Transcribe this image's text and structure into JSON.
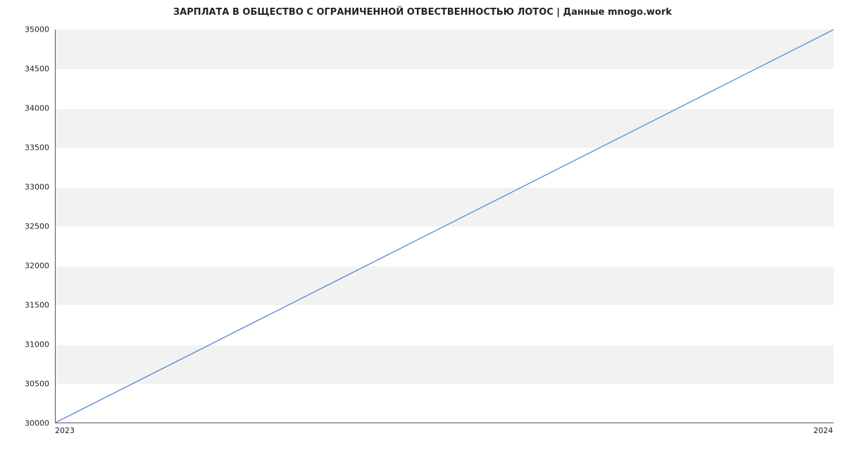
{
  "chart_data": {
    "type": "line",
    "title": "ЗАРПЛАТА В ОБЩЕСТВО С ОГРАНИЧЕННОЙ ОТВЕСТВЕННОСТЬЮ ЛОТОС | Данные mnogo.work",
    "xlabel": "",
    "ylabel": "",
    "x_categories": [
      "2023",
      "2024"
    ],
    "x": [
      2023,
      2024
    ],
    "values": [
      30000,
      35000
    ],
    "y_ticks": [
      30000,
      30500,
      31000,
      31500,
      32000,
      32500,
      33000,
      33500,
      34000,
      34500,
      35000
    ],
    "ylim": [
      30000,
      35000
    ],
    "xlim": [
      "2023",
      "2024"
    ],
    "line_color": "#5a8fd6",
    "stripe_color": "#f2f2f2",
    "grid": true
  }
}
